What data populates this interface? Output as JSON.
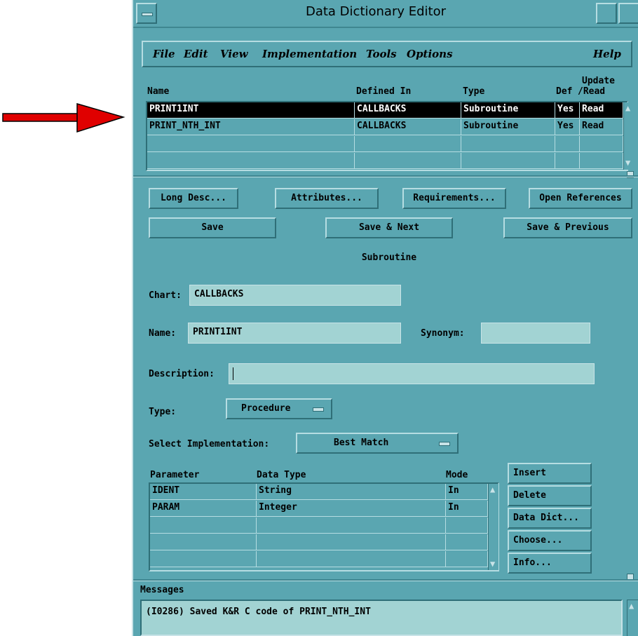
{
  "window": {
    "title": "Data Dictionary Editor"
  },
  "menubar": {
    "items": [
      "File",
      "Edit",
      "View",
      "Implementation",
      "Tools",
      "Options"
    ],
    "help": "Help"
  },
  "entries": {
    "headers": {
      "name": "Name",
      "defined_in": "Defined In",
      "type": "Type",
      "def": "Def",
      "update_top": "Update",
      "update_bottom": "/Read"
    },
    "rows": [
      {
        "name": "PRINT1INT",
        "defined_in": "CALLBACKS",
        "type": "Subroutine",
        "def": "Yes",
        "update": "Read"
      },
      {
        "name": "PRINT_NTH_INT",
        "defined_in": "CALLBACKS",
        "type": "Subroutine",
        "def": "Yes",
        "update": "Read"
      }
    ]
  },
  "buttons": {
    "long_desc": "Long Desc...",
    "attributes": "Attributes...",
    "requirements": "Requirements...",
    "open_references": "Open References",
    "save": "Save",
    "save_next": "Save & Next",
    "save_previous": "Save & Previous"
  },
  "element_kind": "Subroutine",
  "form": {
    "chart_label": "Chart:",
    "chart_value": "CALLBACKS",
    "name_label": "Name:",
    "name_value": "PRINT1INT",
    "synonym_label": "Synonym:",
    "synonym_value": "",
    "description_label": "Description:",
    "description_value": "",
    "type_label": "Type:",
    "type_value": "Procedure",
    "impl_label": "Select Implementation:",
    "impl_value": "Best Match"
  },
  "params": {
    "headers": {
      "parameter": "Parameter",
      "data_type": "Data Type",
      "mode": "Mode"
    },
    "rows": [
      {
        "parameter": "IDENT",
        "data_type": "String",
        "mode": "In"
      },
      {
        "parameter": "PARAM",
        "data_type": "Integer",
        "mode": "In"
      }
    ],
    "buttons": {
      "insert": "Insert",
      "delete": "Delete",
      "data_dict": "Data Dict...",
      "choose": "Choose...",
      "info": "Info..."
    }
  },
  "messages": {
    "label": "Messages",
    "text": "(I0286) Saved K&R C code of PRINT_NTH_INT"
  },
  "colors": {
    "panel": "#5aa6b1",
    "field": "#a2d3d3",
    "arrow": "#e00000"
  }
}
